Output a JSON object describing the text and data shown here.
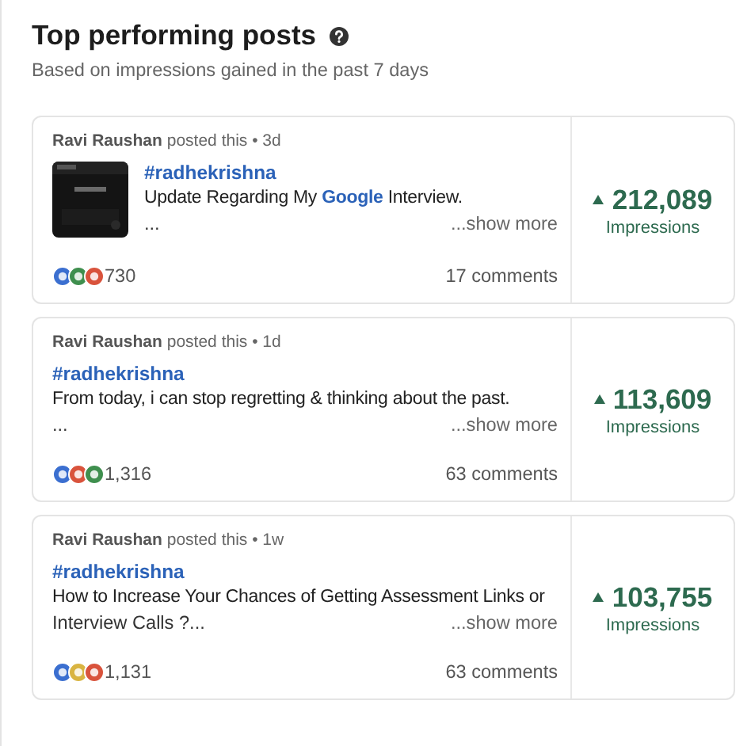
{
  "header": {
    "title": "Top performing posts",
    "subtitle": "Based on impressions gained in the past 7 days"
  },
  "posts": [
    {
      "author": "Ravi Raushan",
      "meta": "posted this • 3d",
      "hashtag": "#radhekrishna",
      "body": [
        {
          "kind": "text",
          "text": "Update Regarding My "
        },
        {
          "kind": "mention",
          "text": "Google"
        },
        {
          "kind": "text",
          "text": " Interview."
        }
      ],
      "tail": "...",
      "show_more": "...show more",
      "reactions": [
        {
          "color": "#3b6fd0"
        },
        {
          "color": "#3f8f4e"
        },
        {
          "color": "#d9533c"
        }
      ],
      "reaction_count": "730",
      "comments": "17 comments",
      "impressions": "212,089",
      "impressions_label": "Impressions"
    },
    {
      "author": "Ravi Raushan",
      "meta": "posted this • 1d",
      "hashtag": "#radhekrishna",
      "body": [
        {
          "kind": "text",
          "text": "From today, i can stop regretting & thinking about the past."
        }
      ],
      "tail": "...",
      "show_more": "...show more",
      "reactions": [
        {
          "color": "#3b6fd0"
        },
        {
          "color": "#d9533c"
        },
        {
          "color": "#3f8f4e"
        }
      ],
      "reaction_count": "1,316",
      "comments": "63 comments",
      "impressions": "113,609",
      "impressions_label": "Impressions"
    },
    {
      "author": "Ravi Raushan",
      "meta": "posted this • 1w",
      "hashtag": "#radhekrishna",
      "body": [
        {
          "kind": "text",
          "text": "How to Increase Your Chances of Getting Assessment Links or"
        }
      ],
      "tail": "Interview Calls ?...",
      "show_more": "...show more",
      "reactions": [
        {
          "color": "#3b6fd0"
        },
        {
          "color": "#d9b441"
        },
        {
          "color": "#d9533c"
        }
      ],
      "reaction_count": "1,131",
      "comments": "63 comments",
      "impressions": "103,755",
      "impressions_label": "Impressions"
    }
  ]
}
